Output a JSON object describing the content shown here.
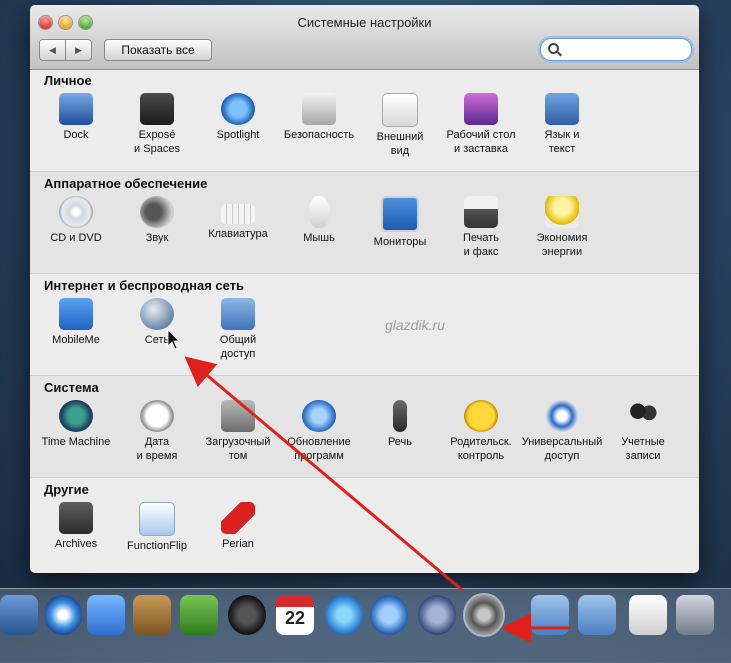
{
  "window": {
    "title": "Системные настройки",
    "show_all": "Показать все",
    "nav_back": "◀",
    "nav_forward": "▶",
    "search_placeholder": ""
  },
  "sections": [
    {
      "title": "Личное",
      "items": [
        {
          "label": "Dock",
          "icon": "dock-icon"
        },
        {
          "label": "Exposé\nи Spaces",
          "icon": "expose-icon"
        },
        {
          "label": "Spotlight",
          "icon": "spotlight-icon"
        },
        {
          "label": "Безопасность",
          "icon": "security-icon"
        },
        {
          "label": "Внешний\nвид",
          "icon": "appearance-icon"
        },
        {
          "label": "Рабочий стол\nи заставка",
          "icon": "desktop-icon"
        },
        {
          "label": "Язык и\nтекст",
          "icon": "language-icon"
        }
      ]
    },
    {
      "title": "Аппаратное обеспечение",
      "items": [
        {
          "label": "CD и DVD",
          "icon": "cd-dvd-icon"
        },
        {
          "label": "Звук",
          "icon": "sound-icon"
        },
        {
          "label": "Клавиатура",
          "icon": "keyboard-icon"
        },
        {
          "label": "Мышь",
          "icon": "mouse-icon"
        },
        {
          "label": "Мониторы",
          "icon": "monitor-icon"
        },
        {
          "label": "Печать\nи факс",
          "icon": "printer-icon"
        },
        {
          "label": "Экономия\nэнергии",
          "icon": "energy-icon"
        }
      ]
    },
    {
      "title": "Интернет и беспроводная сеть",
      "items": [
        {
          "label": "MobileMe",
          "icon": "mobileme-icon"
        },
        {
          "label": "Сеть",
          "icon": "network-icon"
        },
        {
          "label": "Общий\nдоступ",
          "icon": "sharing-icon"
        }
      ]
    },
    {
      "title": "Система",
      "items": [
        {
          "label": "Time Machine",
          "icon": "time-machine-icon"
        },
        {
          "label": "Дата\nи время",
          "icon": "date-time-icon"
        },
        {
          "label": "Загрузочный\nтом",
          "icon": "startup-disk-icon"
        },
        {
          "label": "Обновление\nпрограмм",
          "icon": "software-update-icon"
        },
        {
          "label": "Речь",
          "icon": "speech-icon"
        },
        {
          "label": "Родительск.\nконтроль",
          "icon": "parental-controls-icon"
        },
        {
          "label": "Универсальный\nдоступ",
          "icon": "universal-access-icon"
        },
        {
          "label": "Учетные\nзаписи",
          "icon": "accounts-icon"
        }
      ]
    },
    {
      "title": "Другие",
      "items": [
        {
          "label": "Archives",
          "icon": "archives-icon"
        },
        {
          "label": "FunctionFlip",
          "icon": "functionflip-icon"
        },
        {
          "label": "Perian",
          "icon": "perian-icon"
        }
      ]
    }
  ],
  "watermark": "glazdik.ru",
  "dock": {
    "calendar_day": "22",
    "items": [
      "mail-icon",
      "safari-icon",
      "ichat-icon",
      "address-book-icon",
      "ical-icon",
      "ichat-video-icon",
      "calendar-icon",
      "itunes-icon",
      "front-row-icon",
      "preview-icon",
      "system-preferences-icon",
      "applications-folder-icon",
      "documents-folder-icon",
      "file-icon",
      "trash-icon"
    ]
  },
  "colors": {
    "annotation_arrow": "#e0201a",
    "window_bg": "#ececec",
    "search_focus": "#9cc0ea"
  }
}
